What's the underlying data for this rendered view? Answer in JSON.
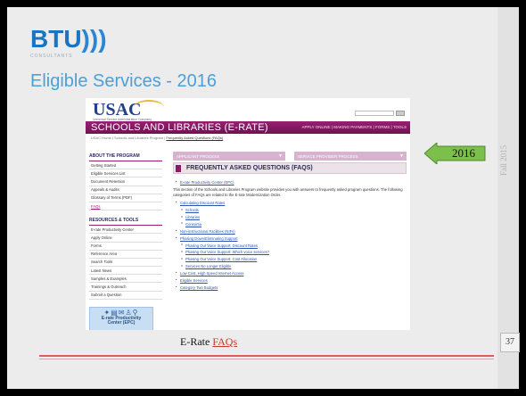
{
  "slide": {
    "logo_text": "BTU",
    "logo_waves": ")))",
    "logo_sub": "CONSULTANTS",
    "title": "Eligible Services - 2016",
    "side_label": "Fall 2015",
    "page_number": "37",
    "arrow_label": "2016",
    "caption_prefix": "E-Rate ",
    "caption_link": "FAQs",
    "colors": {
      "accent": "#4aa0d8",
      "arrow_fill": "#7cbf4c",
      "link_red": "#c0392b"
    }
  },
  "website": {
    "logo": "USAC",
    "logo_sub": "Universal Service Administrative Company",
    "banner_title": "SCHOOLS AND LIBRARIES (E-RATE)",
    "banner_links": "APPLY ONLINE | MAKING PAYMENTS | FORMS | TOOLS",
    "breadcrumb": "USAC Home | Schools and Libraries Program |",
    "breadcrumb_current": "Frequently Asked Questions (FAQs)",
    "sidebar": {
      "section1_title": "ABOUT THE PROGRAM",
      "section1_items": [
        "Getting Started",
        "Eligible Services List",
        "Document Retention",
        "Appeals & Audits",
        "Glossary of Terms (PDF)",
        "FAQs"
      ],
      "section2_title": "RESOURCES & TOOLS",
      "section2_items": [
        "E-rate Productivity Center",
        "Apply Online",
        "Forms",
        "Reference Area",
        "Search Tools",
        "Latest News",
        "Samples & Examples",
        "Trainings & Outreach",
        "Submit a Question"
      ],
      "epc_icons": "✦▤✉♙⚲",
      "epc_line1": "E-rate Productivity",
      "epc_line2": "Center (EPC)"
    },
    "tabs": {
      "applicant": "APPLICANT PROCESS",
      "provider": "SERVICE PROVIDER PROCESS"
    },
    "faq_heading": "FREQUENTLY ASKED QUESTIONS (FAQS)",
    "epc_link": "E-rate Productivity Center (EPC)",
    "intro": "This section of the Schools and Libraries Program website provides you with answers to frequently asked program questions. The following categories of FAQs are related to the E-rate Modernization Order.",
    "faq_items": {
      "i1": "Calculating Discount Rates",
      "i1a": "Schools",
      "i1b": "Libraries",
      "i1c": "Consortia",
      "i2": "Non-instructional Facilities (NIFs)",
      "i3": "Phasing Down/Eliminating Support",
      "i3a": "Phasing Out Voice Support: Discount Rates",
      "i3b": "Phasing Out Voice Support: Which voice services?",
      "i3c": "Phasing Out Voice Support: Cost Allocation",
      "i3d": "Services No Longer Eligible",
      "i4": "Low Cost, High Speed Internet Access",
      "i5": "Eligible Services",
      "i6": "Category Two Budgets"
    }
  }
}
